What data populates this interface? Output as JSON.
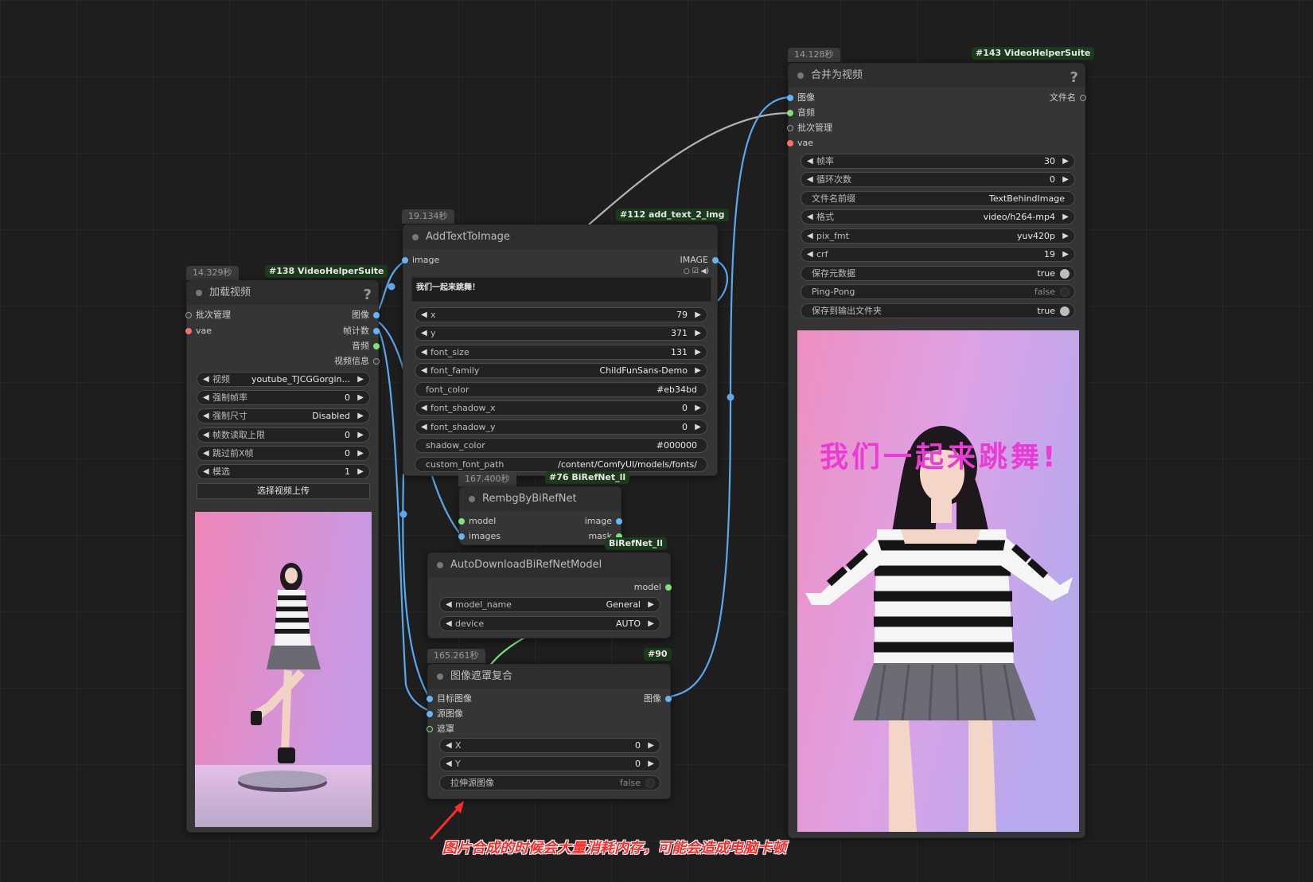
{
  "node_load_video": {
    "time": "14.329秒",
    "id": "#138 VideoHelperSuite",
    "title": "加载视频",
    "help": "?",
    "inputs": [
      "批次管理",
      "vae"
    ],
    "outputs": [
      "图像",
      "帧计数",
      "音频",
      "视频信息"
    ],
    "widgets": [
      {
        "label": "视频",
        "value": "youtube_TJCGGorgin..."
      },
      {
        "label": "强制帧率",
        "value": "0"
      },
      {
        "label": "强制尺寸",
        "value": "Disabled"
      },
      {
        "label": "帧数读取上限",
        "value": "0"
      },
      {
        "label": "跳过前X帧",
        "value": "0"
      },
      {
        "label": "模选",
        "value": "1"
      }
    ],
    "upload_button": "选择视频上传"
  },
  "node_add_text": {
    "time": "19.134秒",
    "id": "#112 add_text_2_img",
    "title": "AddTextToImage",
    "input": "image",
    "output": "IMAGE",
    "text": "我们一起来跳舞！",
    "widgets": [
      {
        "label": "x",
        "value": "79"
      },
      {
        "label": "y",
        "value": "371"
      },
      {
        "label": "font_size",
        "value": "131"
      },
      {
        "label": "font_family",
        "value": "ChildFunSans-Demo"
      },
      {
        "label": "font_color",
        "value": "#eb34bd"
      },
      {
        "label": "font_shadow_x",
        "value": "0"
      },
      {
        "label": "font_shadow_y",
        "value": "0"
      },
      {
        "label": "shadow_color",
        "value": "#000000"
      },
      {
        "label": "custom_font_path",
        "value": "/content/ComfyUI/models/fonts/"
      }
    ]
  },
  "node_rembg": {
    "time": "167.400秒",
    "id": "#76 BiRefNet_ll",
    "title": "RembgByBiRefNet",
    "inputs": [
      "model",
      "images"
    ],
    "outputs": [
      "image",
      "mask"
    ]
  },
  "node_autodownload": {
    "id": "BiRefNet_ll",
    "title": "AutoDownloadBiRefNetModel",
    "output": "model",
    "widgets": [
      {
        "label": "model_name",
        "value": "General"
      },
      {
        "label": "device",
        "value": "AUTO"
      }
    ]
  },
  "node_composite": {
    "time": "165.261秒",
    "id": "#90",
    "title": "图像遮罩复合",
    "inputs": [
      "目标图像",
      "源图像",
      "遮罩"
    ],
    "output": "图像",
    "widgets": [
      {
        "label": "X",
        "value": "0"
      },
      {
        "label": "Y",
        "value": "0"
      }
    ],
    "toggle": {
      "label": "拉伸源图像",
      "value": "false"
    }
  },
  "node_combine": {
    "time": "14.128秒",
    "id": "#143 VideoHelperSuite",
    "title": "合并为视频",
    "help": "?",
    "inputs": [
      "图像",
      "音频",
      "批次管理",
      "vae"
    ],
    "output": "文件名",
    "widgets": [
      {
        "label": "帧率",
        "value": "30"
      },
      {
        "label": "循环次数",
        "value": "0"
      }
    ],
    "prefix": {
      "label": "文件名前缀",
      "value": "TextBehindImage"
    },
    "widgets2": [
      {
        "label": "格式",
        "value": "video/h264-mp4"
      },
      {
        "label": "pix_fmt",
        "value": "yuv420p"
      },
      {
        "label": "crf",
        "value": "19"
      }
    ],
    "toggles": [
      {
        "label": "保存元数据",
        "value": "true"
      },
      {
        "label": "Ping-Pong",
        "value": "false"
      },
      {
        "label": "保存到输出文件夹",
        "value": "true"
      }
    ],
    "overlay_text": "我们一起来跳舞!"
  },
  "annotation": "图片合成的时候会大量消耗内存，可能会造成电脑卡顿",
  "colors": {
    "wire_image": "#5aa8ee",
    "wire_gray": "#aeb6ae",
    "wire_green": "#7ee27e",
    "font_color": "#eb34bd"
  }
}
